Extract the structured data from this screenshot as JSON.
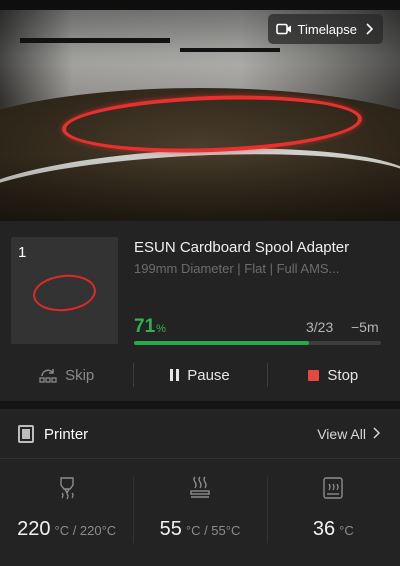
{
  "camera": {
    "timelapse_label": "Timelapse",
    "timelapse_icon": "video-camera-icon"
  },
  "job": {
    "thumbnail_number": "1",
    "title": "ESUN Cardboard Spool Adapter",
    "subtitle": "199mm Diameter | Flat | Full AMS...",
    "progress_percent": "71",
    "progress_unit": "%",
    "progress_fraction": 0.71,
    "layers": "3/23",
    "time_remaining": "−5m",
    "accent_color": "#1fae45"
  },
  "actions": {
    "skip_label": "Skip",
    "pause_label": "Pause",
    "stop_label": "Stop",
    "stop_color": "#e5483f"
  },
  "printer": {
    "title": "Printer",
    "view_all_label": "View All",
    "nozzle": {
      "current": "220",
      "detail": "°C / 220°C",
      "icon": "nozzle-heat-icon"
    },
    "bed": {
      "current": "55",
      "detail": "°C / 55°C",
      "icon": "bed-heat-icon"
    },
    "chamber": {
      "current": "36",
      "detail": "°C",
      "icon": "chamber-heat-icon"
    }
  }
}
